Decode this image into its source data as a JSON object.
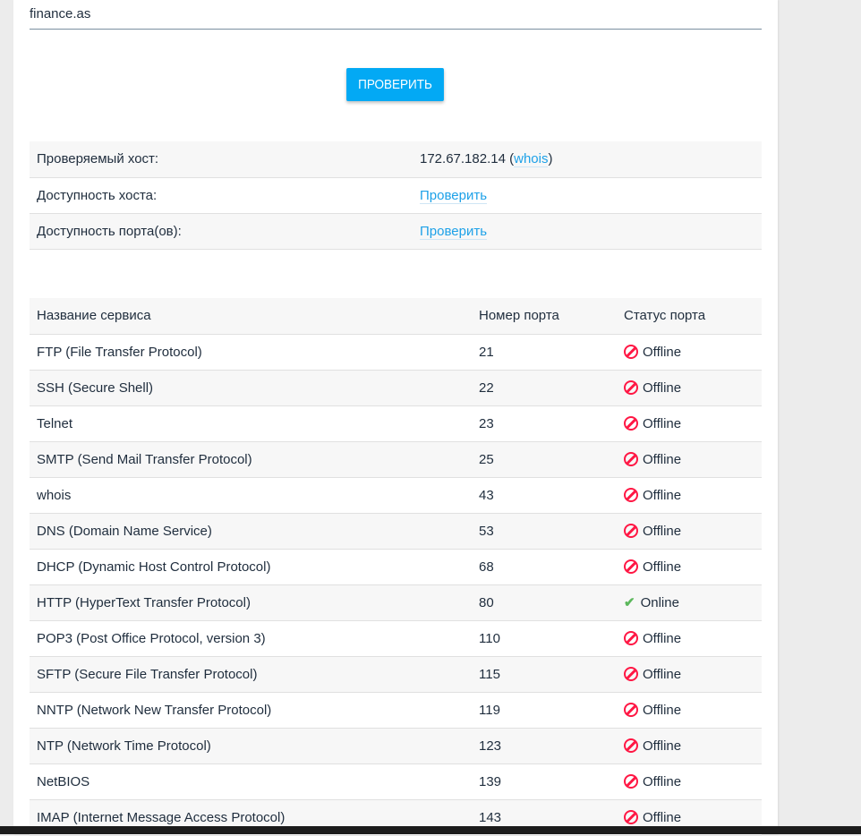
{
  "form": {
    "host_value": "finance.as",
    "submit_label": "ПРОВЕРИТЬ"
  },
  "info": {
    "rows": [
      {
        "label": "Проверяемый хост:",
        "value": "172.67.182.14",
        "link": "whois"
      },
      {
        "label": "Доступность хоста:",
        "link": "Проверить"
      },
      {
        "label": "Доступность порта(ов):",
        "link": "Проверить"
      }
    ]
  },
  "ports": {
    "headers": [
      "Название сервиса",
      "Номер порта",
      "Статус порта"
    ],
    "rows": [
      {
        "service": "FTP (File Transfer Protocol)",
        "port": "21",
        "status": "Offline"
      },
      {
        "service": "SSH (Secure Shell)",
        "port": "22",
        "status": "Offline"
      },
      {
        "service": "Telnet",
        "port": "23",
        "status": "Offline"
      },
      {
        "service": "SMTP (Send Mail Transfer Protocol)",
        "port": "25",
        "status": "Offline"
      },
      {
        "service": "whois",
        "port": "43",
        "status": "Offline"
      },
      {
        "service": "DNS (Domain Name Service)",
        "port": "53",
        "status": "Offline"
      },
      {
        "service": "DHCP (Dynamic Host Control Protocol)",
        "port": "68",
        "status": "Offline"
      },
      {
        "service": "HTTP (HyperText Transfer Protocol)",
        "port": "80",
        "status": "Online"
      },
      {
        "service": "POP3 (Post Office Protocol, version 3)",
        "port": "110",
        "status": "Offline"
      },
      {
        "service": "SFTP (Secure File Transfer Protocol)",
        "port": "115",
        "status": "Offline"
      },
      {
        "service": "NNTP (Network New Transfer Protocol)",
        "port": "119",
        "status": "Offline"
      },
      {
        "service": "NTP (Network Time Protocol)",
        "port": "123",
        "status": "Offline"
      },
      {
        "service": "NetBIOS",
        "port": "139",
        "status": "Offline"
      },
      {
        "service": "IMAP (Internet Message Access Protocol)",
        "port": "143",
        "status": "Offline"
      }
    ]
  }
}
